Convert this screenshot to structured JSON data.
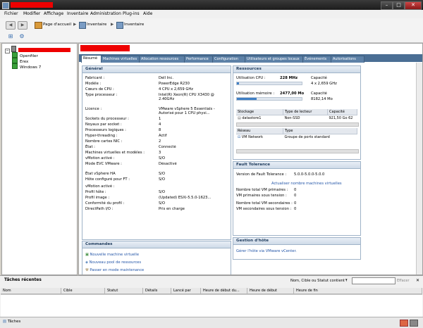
{
  "window": {
    "controls": [
      "–",
      "□",
      "✕"
    ]
  },
  "menu": [
    "Fichier",
    "Modifier",
    "Affichage",
    "Inventaire",
    "Administration",
    "Plug-ins",
    "Aide"
  ],
  "nav": {
    "back": "◀",
    "forward": "▶",
    "crumbs": [
      "Page d'accueil",
      "Inventaire",
      "Inventaire"
    ]
  },
  "tree": {
    "vms": [
      "Openfiler",
      "Erex",
      "Windows 7"
    ]
  },
  "tabs": [
    "Résumé",
    "Machines virtuelles",
    "Allocation ressources",
    "Performance",
    "Configuration",
    "Utilisateurs et groupes locaux",
    "Événements",
    "Autorisations"
  ],
  "general": {
    "title": "Général",
    "rows": [
      {
        "label": "Fabricant :",
        "value": "Dell Inc."
      },
      {
        "label": "Modèle :",
        "value": "PowerEdge R230"
      },
      {
        "label": "Cœurs de CPU :",
        "value": "4 CPU x 2,659 GHz"
      },
      {
        "label": "Type processeur :",
        "value": "Intel(R) Xeon(R) CPU X3430 @ 2.40GHz"
      },
      {
        "label": "Licence :",
        "value": "VMware vSphere 5 Essentials - Autorisé pour 1 CPU physi..."
      },
      {
        "label": "Sockets du processeur :",
        "value": "1"
      },
      {
        "label": "Noyaux par socket :",
        "value": "4"
      },
      {
        "label": "Processeurs logiques :",
        "value": "8"
      },
      {
        "label": "Hyper-threading :",
        "value": "Actif"
      },
      {
        "label": "Nombre cartes NIC :",
        "value": "2"
      },
      {
        "label": "État :",
        "value": "Connecté"
      },
      {
        "label": "Machines virtuelles et modèles :",
        "value": "3"
      },
      {
        "label": "vMotion activé :",
        "value": "S/O"
      },
      {
        "label": "Mode EVC VMware :",
        "value": "Désactivé"
      },
      {
        "label": "État vSphere HA",
        "value": "S/O"
      },
      {
        "label": "Hôte configuré pour FT :",
        "value": "S/O"
      },
      {
        "label": "vMotion activé :",
        "value": ""
      },
      {
        "label": "Profil hôte :",
        "value": "S/O"
      },
      {
        "label": "Profil image :",
        "value": "(Updated) ESXi-5.5.0-1623..."
      },
      {
        "label": "Conformité du profil :",
        "value": "S/O"
      },
      {
        "label": "DirectPath I/O :",
        "value": "Pris en charge"
      }
    ]
  },
  "commands": {
    "title": "Commandes",
    "items": [
      "Nouvelle machine virtuelle",
      "Nouveau pool de ressources",
      "Passer en mode maintenance"
    ]
  },
  "resources": {
    "title": "Ressources",
    "cpu_label": "Utilisation CPU :",
    "cpu_value": "228 MHz",
    "cpu_cap_label": "Capacité",
    "cpu_cap_value": "4 x 2,659 GHz",
    "cpu_fraction": 0.03,
    "mem_label": "Utilisation mémoire :",
    "mem_value": "2477,00 Mo",
    "mem_cap_label": "Capacité",
    "mem_cap_value": "8182,14 Mo",
    "mem_fraction": 0.3,
    "storage_headers": [
      "Stockage",
      "Type de lecteur",
      "Capacité"
    ],
    "storage_rows": [
      {
        "name": "datastore1",
        "type": "Non-SSD",
        "capacity": "921,50 Go",
        "extra": "62"
      }
    ],
    "network_headers": [
      "Réseau",
      "Type"
    ],
    "network_rows": [
      {
        "name": "VM Network",
        "type": "Groupe de ports standard"
      }
    ]
  },
  "ft": {
    "title": "Fault Tolerance",
    "version_label": "Version de Fault Tolerance :",
    "version_value": "5.0.0-5.0.0-5.0.0",
    "refresh_link": "Actualiser nombre machines virtuelles",
    "rows": [
      {
        "label": "Nombre total VM primaires :",
        "value": "0"
      },
      {
        "label": "VM primaires sous tension :",
        "value": "0"
      },
      {
        "label": "Nombre total VM secondaires :",
        "value": "0"
      },
      {
        "label": "VM secondaires sous tension :",
        "value": "0"
      }
    ]
  },
  "host_mgmt": {
    "title": "Gestion d'hôte",
    "link": "Gérer l'hôte via VMware vCenter."
  },
  "tasks": {
    "title": "Tâches récentes",
    "filter_label": "Nom, Cible ou Statut contient :",
    "clear": "Effacer",
    "columns": [
      "Nom",
      "Cible",
      "Statut",
      "Détails",
      "Lancé par",
      "Heure de début du...",
      "Heure de début",
      "Heure de fin"
    ]
  },
  "status": {
    "tasks_label": "Tâches"
  }
}
